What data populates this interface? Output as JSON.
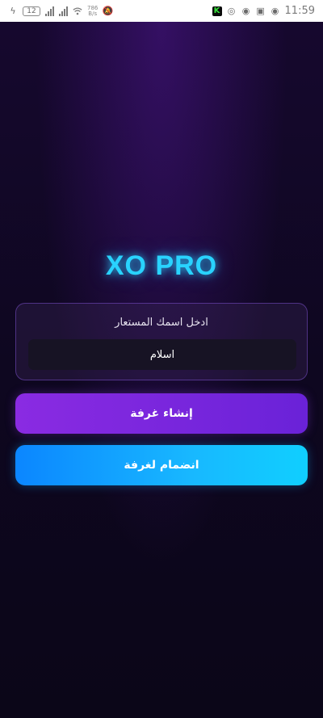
{
  "status_bar": {
    "battery": "12",
    "net_speed_top": "786",
    "net_speed_bottom": "B/s",
    "time": "11:59"
  },
  "app": {
    "title": "XO PRO",
    "name_label": "ادخل اسمك المستعار",
    "name_value": "اسلام",
    "create_room_label": "إنشاء غرفة",
    "join_room_label": "انضمام لغرفة"
  },
  "colors": {
    "background": "#0b0618",
    "title": "#29d3ff",
    "create_button": "#7b27e0",
    "join_button": "#10b4ff"
  },
  "icons": [
    "battery-icon",
    "signal-icon",
    "wifi-icon",
    "mute-icon",
    "k-app-icon",
    "chrome-icon",
    "messenger-icon",
    "security-icon",
    "eye-icon"
  ]
}
